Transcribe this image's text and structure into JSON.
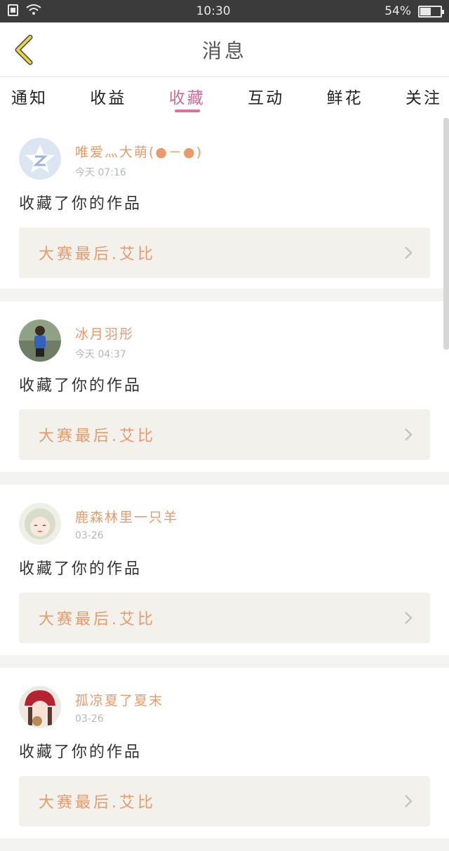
{
  "status_bar": {
    "time": "10:30",
    "battery": "54%",
    "battery_level": 0.54,
    "icons": [
      "sim-icon",
      "wifi-icon",
      "battery-icon"
    ]
  },
  "header": {
    "title": "消息",
    "back_icon": "chevron-left-icon",
    "accent_color": "#e8d44a"
  },
  "tabs": [
    {
      "label": "通知",
      "active": false
    },
    {
      "label": "收益",
      "active": false
    },
    {
      "label": "收藏",
      "active": true
    },
    {
      "label": "互动",
      "active": false
    },
    {
      "label": "鲜花",
      "active": false
    },
    {
      "label": "关注",
      "active": false
    }
  ],
  "colors": {
    "active_tab": "#d06b9a",
    "username": "#e89a6a",
    "work_title": "#e89a6a"
  },
  "items": [
    {
      "name": "唯爱灬大萌(●－●)",
      "time": "今天 07:16",
      "action": "收藏了你的作品",
      "work": "大赛最后.艾比",
      "avatar": "qzone-star-avatar"
    },
    {
      "name": "冰月羽彤",
      "time": "今天 04:37",
      "action": "收藏了你的作品",
      "work": "大赛最后.艾比",
      "avatar": "photo-avatar"
    },
    {
      "name": "鹿森林里一只羊",
      "time": "03-26",
      "action": "收藏了你的作品",
      "work": "大赛最后.艾比",
      "avatar": "anime-avatar"
    },
    {
      "name": "孤凉夏了夏末",
      "time": "03-26",
      "action": "收藏了你的作品",
      "work": "大赛最后.艾比",
      "avatar": "red-hat-avatar"
    }
  ]
}
